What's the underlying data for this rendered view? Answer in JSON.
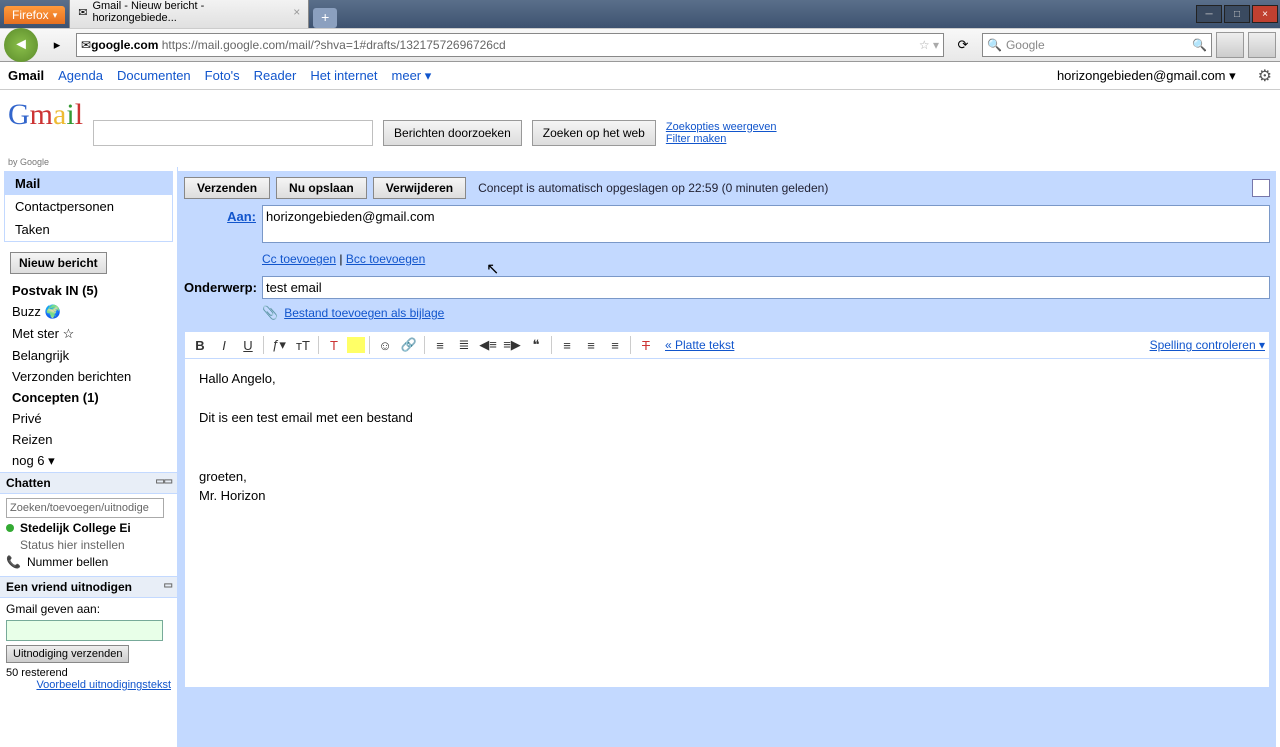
{
  "firefox": {
    "menu_label": "Firefox",
    "tab_title": "Gmail - Nieuw bericht - horizongebiede...",
    "url_domain": "google.com",
    "url_path": "https://mail.google.com/mail/?shva=1#drafts/13217572696726cd",
    "search_placeholder": "Google"
  },
  "toplinks": {
    "items": [
      "Gmail",
      "Agenda",
      "Documenten",
      "Foto's",
      "Reader",
      "Het internet",
      "meer ▾"
    ],
    "user": "horizongebieden@gmail.com ▾"
  },
  "search": {
    "btn1": "Berichten doorzoeken",
    "btn2": "Zoeken op het web",
    "link1": "Zoekopties weergeven",
    "link2": "Filter maken"
  },
  "sidebar": {
    "navs": [
      "Mail",
      "Contactpersonen",
      "Taken"
    ],
    "compose": "Nieuw bericht",
    "folders": [
      {
        "label": "Postvak IN (5)",
        "bold": true
      },
      {
        "label": "Buzz 🌍",
        "bold": false
      },
      {
        "label": "Met ster ☆",
        "bold": false
      },
      {
        "label": "Belangrijk",
        "bold": false
      },
      {
        "label": "Verzonden berichten",
        "bold": false
      },
      {
        "label": "Concepten (1)",
        "bold": true
      },
      {
        "label": "Privé",
        "bold": false
      },
      {
        "label": "Reizen",
        "bold": false
      },
      {
        "label": "nog 6 ▾",
        "bold": false
      }
    ],
    "chat_header": "Chatten",
    "chat_search": "Zoeken/toevoegen/uitnodige",
    "chat_name": "Stedelijk College Ei",
    "chat_status": "Status hier instellen",
    "chat_call": "Nummer bellen",
    "invite_header": "Een vriend uitnodigen",
    "invite_sub": "Gmail geven aan:",
    "invite_btn": "Uitnodiging verzenden",
    "invite_left": "50 resterend",
    "invite_preview": "Voorbeeld uitnodigingstekst"
  },
  "compose": {
    "send": "Verzenden",
    "save": "Nu opslaan",
    "discard": "Verwijderen",
    "autosave": "Concept is automatisch opgeslagen op 22:59 (0 minuten geleden)",
    "to_label": "Aan:",
    "to_value": "horizongebieden@gmail.com",
    "cc": "Cc toevoegen",
    "bcc": "Bcc toevoegen",
    "subject_label": "Onderwerp:",
    "subject_value": "test email",
    "attach": "Bestand toevoegen als bijlage",
    "plain": "« Platte tekst",
    "spell": "Spelling controleren ▾",
    "body": "Hallo Angelo,\n\nDit is een test email met een bestand\n\n\ngroeten,\nMr. Horizon"
  }
}
